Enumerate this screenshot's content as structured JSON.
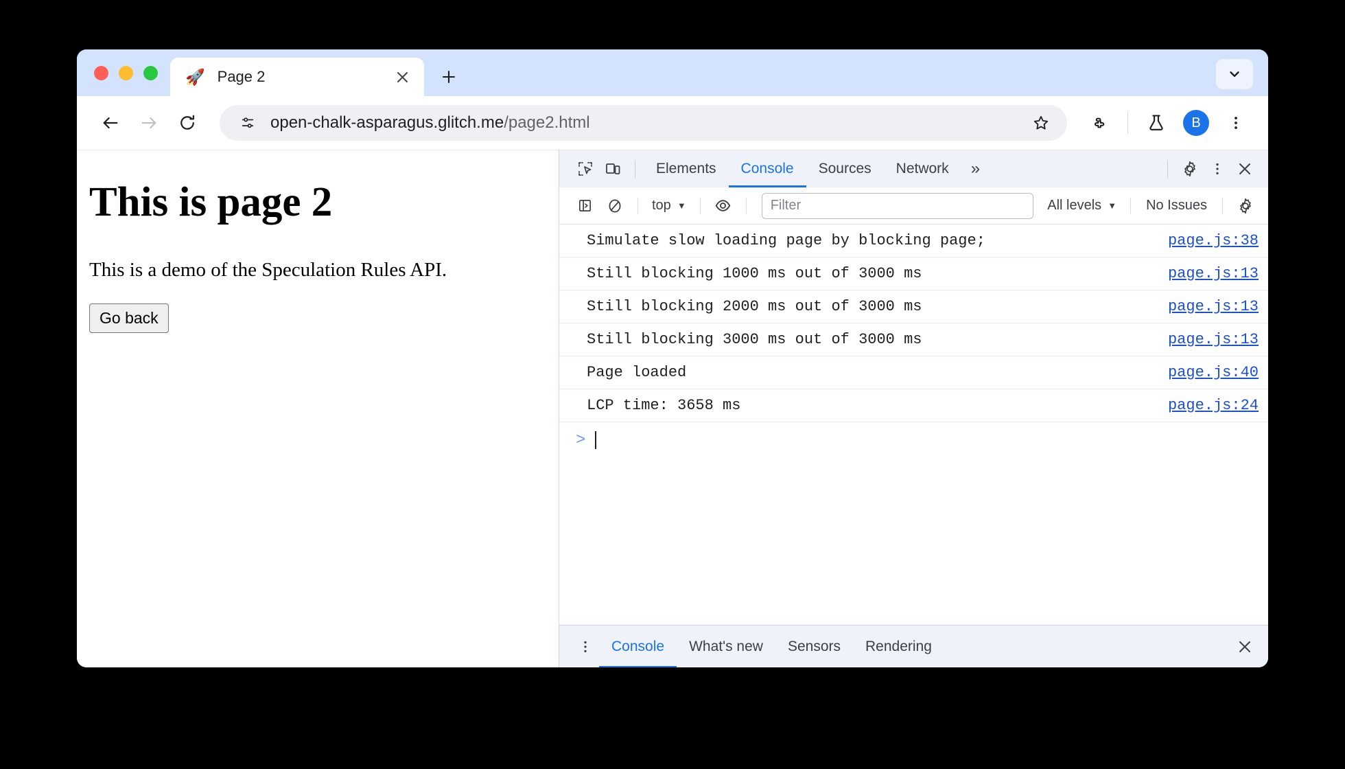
{
  "browser": {
    "tab": {
      "favicon": "rocket-icon",
      "title": "Page 2",
      "close_label": "×"
    },
    "new_tab_label": "+",
    "tab_search_icon": "chevron-down-icon",
    "toolbar": {
      "back_icon": "back-arrow-icon",
      "forward_icon": "forward-arrow-icon",
      "reload_icon": "reload-icon",
      "site_info_icon": "tune-icon",
      "url_host": "open-chalk-asparagus.glitch.me",
      "url_path": "/page2.html",
      "url_full": "open-chalk-asparagus.glitch.me/page2.html",
      "bookmark_icon": "star-icon",
      "extensions_icon": "puzzle-icon",
      "labs_icon": "flask-icon",
      "avatar_initial": "B",
      "menu_icon": "kebab-menu-icon"
    }
  },
  "page": {
    "heading": "This is page 2",
    "paragraph": "This is a demo of the Speculation Rules API.",
    "back_button": "Go back"
  },
  "devtools": {
    "inspect_icon": "inspect-element-icon",
    "device_icon": "device-toolbar-icon",
    "tabs": [
      {
        "label": "Elements",
        "active": false
      },
      {
        "label": "Console",
        "active": true
      },
      {
        "label": "Sources",
        "active": false
      },
      {
        "label": "Network",
        "active": false
      }
    ],
    "more_tabs_label": "»",
    "settings_icon": "gear-icon",
    "menu_icon": "kebab-menu-icon",
    "close_icon": "close-icon",
    "console_toolbar": {
      "sidebar_icon": "console-sidebar-icon",
      "clear_icon": "clear-console-icon",
      "context_label": "top",
      "eye_icon": "live-expression-eye-icon",
      "filter_placeholder": "Filter",
      "filter_value": "",
      "levels_label": "All levels",
      "issues_label": "No Issues",
      "settings_icon": "gear-icon"
    },
    "messages": [
      {
        "text": "Simulate slow loading page by blocking page;",
        "source": "page.js:38"
      },
      {
        "text": "Still blocking 1000 ms out of 3000 ms",
        "source": "page.js:13"
      },
      {
        "text": "Still blocking 2000 ms out of 3000 ms",
        "source": "page.js:13"
      },
      {
        "text": "Still blocking 3000 ms out of 3000 ms",
        "source": "page.js:13"
      },
      {
        "text": "Page loaded",
        "source": "page.js:40"
      },
      {
        "text": "LCP time: 3658 ms",
        "source": "page.js:24"
      }
    ],
    "prompt": {
      "chevron": ">",
      "value": ""
    },
    "drawer": {
      "menu_icon": "kebab-menu-icon",
      "tabs": [
        {
          "label": "Console",
          "active": true
        },
        {
          "label": "What's new",
          "active": false
        },
        {
          "label": "Sensors",
          "active": false
        },
        {
          "label": "Rendering",
          "active": false
        }
      ],
      "close_icon": "close-icon"
    }
  },
  "colors": {
    "tab_strip_bg": "#d3e3fd",
    "accent_blue": "#1a73e8",
    "link_blue": "#1a4fd6",
    "devtools_chrome": "#eff2f9"
  }
}
